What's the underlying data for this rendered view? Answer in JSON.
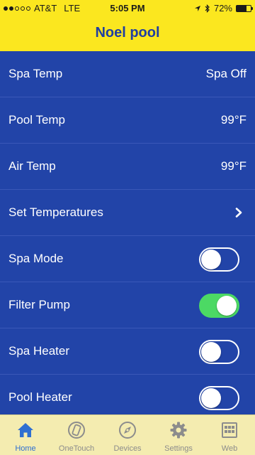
{
  "status_bar": {
    "carrier": "AT&T",
    "network": "LTE",
    "time": "5:05 PM",
    "battery_percent": "72%",
    "battery_level": 0.72,
    "signal_bars_filled": 2,
    "signal_bars_total": 5
  },
  "header": {
    "title": "Noel pool"
  },
  "rows": [
    {
      "label": "Spa Temp",
      "value": "Spa Off"
    },
    {
      "label": "Pool Temp",
      "value": "99°F"
    },
    {
      "label": "Air Temp",
      "value": "99°F"
    },
    {
      "label": "Set Temperatures"
    },
    {
      "label": "Spa Mode",
      "toggle_on": false
    },
    {
      "label": "Filter Pump",
      "toggle_on": true
    },
    {
      "label": "Spa Heater",
      "toggle_on": false
    },
    {
      "label": "Pool Heater",
      "toggle_on": false
    }
  ],
  "tabs": [
    {
      "label": "Home",
      "icon": "home-icon",
      "active": true
    },
    {
      "label": "OneTouch",
      "icon": "onetouch-icon",
      "active": false
    },
    {
      "label": "Devices",
      "icon": "devices-icon",
      "active": false
    },
    {
      "label": "Settings",
      "icon": "gear-icon",
      "active": false
    },
    {
      "label": "Web",
      "icon": "web-grid-icon",
      "active": false
    }
  ],
  "colors": {
    "header_background": "#fbe71f",
    "title": "#1f3ea3",
    "list_background": "#2244a8",
    "toggle_on": "#4cd964",
    "tab_active": "#2f6fd1",
    "tab_inactive": "#8c8c8c",
    "tabbar_background": "#f4ecb0"
  }
}
